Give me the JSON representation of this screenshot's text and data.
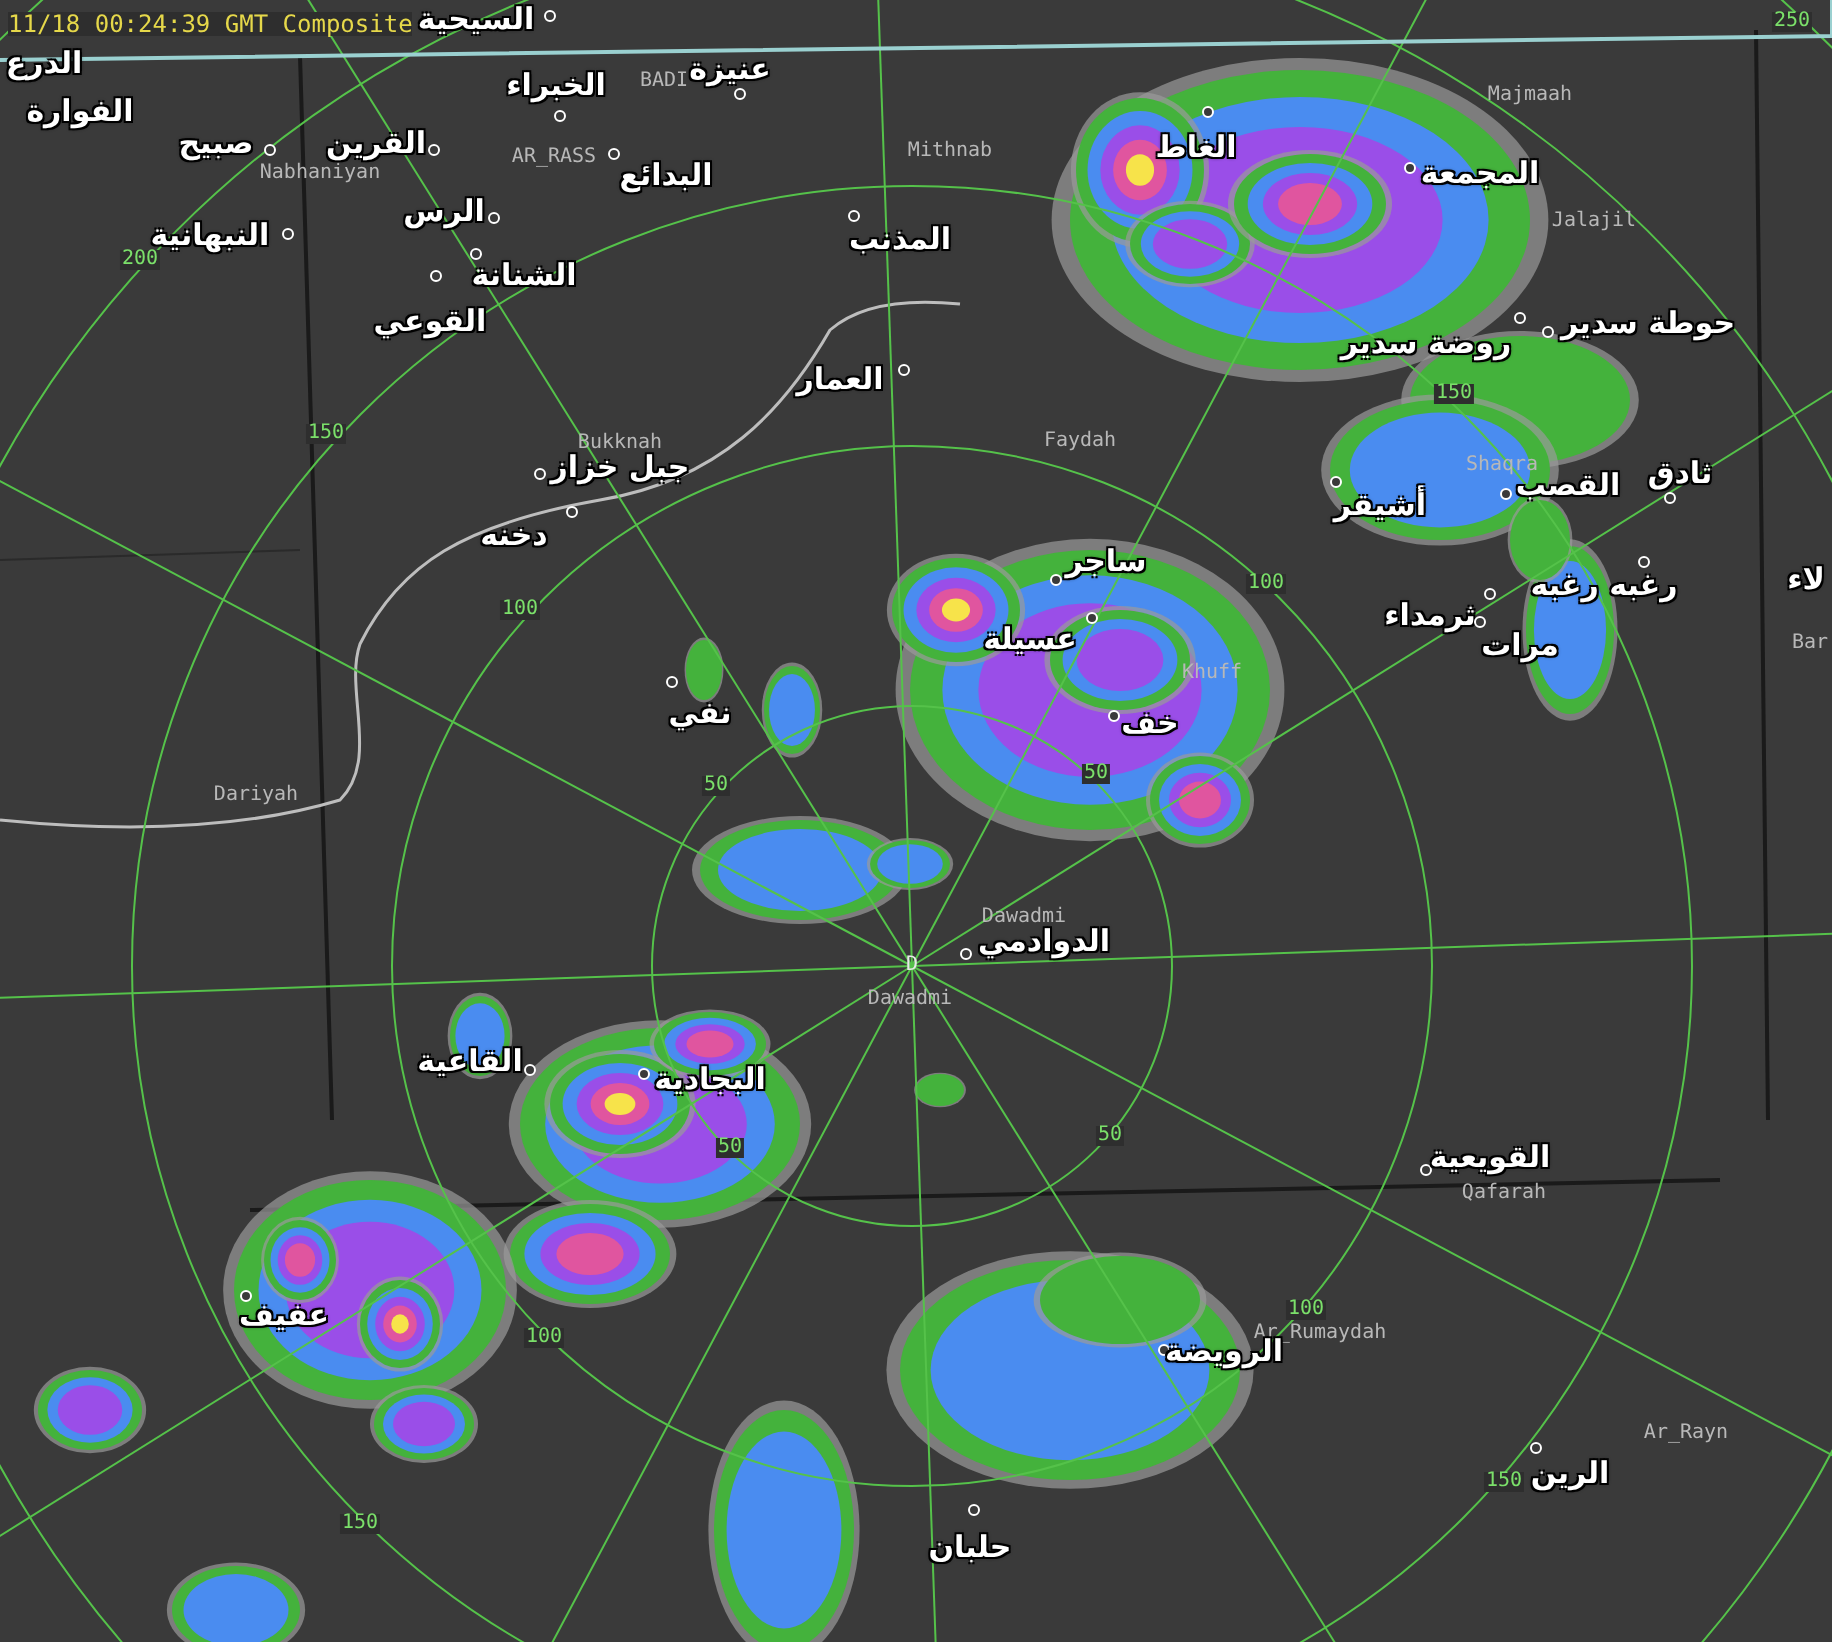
{
  "header": {
    "timestamp": "11/18 00:24:39 GMT Composite"
  },
  "radar": {
    "site_marker": "D"
  },
  "places": [
    {
      "name": "الدرع"
    },
    {
      "name": "السيحية"
    },
    {
      "name": "الفوارة"
    },
    {
      "name": "القرين"
    },
    {
      "name": "صبيح"
    },
    {
      "name": "الخبراء"
    },
    {
      "name": "عنيزة"
    },
    {
      "name": "البدائع"
    },
    {
      "name": "الرس"
    },
    {
      "name": "النبهانية"
    },
    {
      "name": "الشنانة"
    },
    {
      "name": "القوعي"
    },
    {
      "name": "المذنب"
    },
    {
      "name": "العمار"
    },
    {
      "name": "جبل خزاز"
    },
    {
      "name": "دخنه"
    },
    {
      "name": "الغاط"
    },
    {
      "name": "المجمعة"
    },
    {
      "name": "حوطة سدير"
    },
    {
      "name": "روضة سدير"
    },
    {
      "name": "أشيقر"
    },
    {
      "name": "ثادق"
    },
    {
      "name": "القصب"
    },
    {
      "name": "ساجر"
    },
    {
      "name": "عسيلة"
    },
    {
      "name": "خف"
    },
    {
      "name": "رغبه رغبه"
    },
    {
      "name": "ثرمداء"
    },
    {
      "name": "مرات"
    },
    {
      "name": "لاء"
    },
    {
      "name": "نفي"
    },
    {
      "name": "الدوادمي"
    },
    {
      "name": "القاعية"
    },
    {
      "name": "البجادية"
    },
    {
      "name": "القويعية"
    },
    {
      "name": "عفيف"
    },
    {
      "name": "الرويضة"
    },
    {
      "name": "الرين"
    },
    {
      "name": "حلبان"
    }
  ],
  "map_labels": [
    "BADI",
    "AR_RASS",
    "Nabhaniyan",
    "Mithnab",
    "Bukknah",
    "Majmaah",
    "Jalajil",
    "Faydah",
    "Shaqra",
    "Khuff",
    "Bar",
    "Dariyah",
    "Dawadmi",
    "Dawadmi",
    "Qafarah",
    "Ar_Rumaydah",
    "Ar_Rayn"
  ],
  "range_labels": [
    "250",
    "200",
    "150",
    "100",
    "50",
    "100",
    "50",
    "150",
    "50",
    "100",
    "150",
    "50",
    "100",
    "150"
  ]
}
